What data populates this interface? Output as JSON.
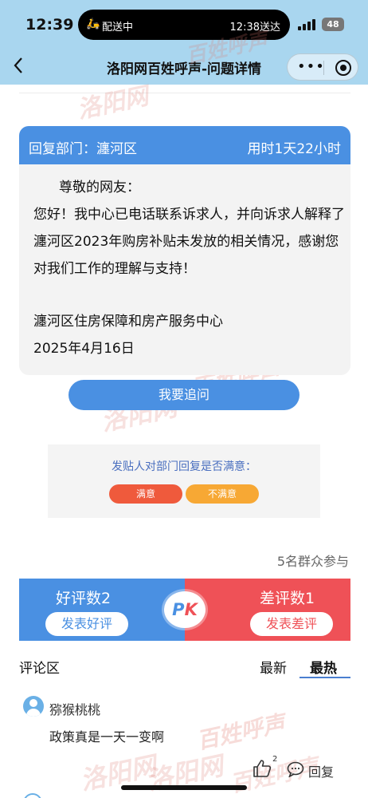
{
  "status_bar": {
    "time": "12:39",
    "island_left": "配送中",
    "island_right": "12:38送达",
    "battery": "48"
  },
  "nav": {
    "title": "洛阳网百姓呼声-问题详情"
  },
  "watermark": {
    "brand": "百姓呼声",
    "site": "洛阳网"
  },
  "reply": {
    "department": "回复部门：瀍河区",
    "elapsed": "用时1天22小时",
    "greeting": "尊敬的网友：",
    "content": "您好！我中心已电话联系诉求人，并向诉求人解释了瀍河区2023年购房补贴未发放的相关情况，感谢您对我们工作的理解与支持！",
    "signature_org": "瀍河区住房保障和房产服务中心",
    "signature_date": "2025年4月16日"
  },
  "follow_up_button": "我要追问",
  "satisfaction": {
    "question": "发贴人对部门回复是否满意：",
    "satisfied": "满意",
    "unsatisfied": "不满意"
  },
  "participants": "5名群众参与",
  "pk": {
    "good_count_label": "好评数2",
    "good_button": "发表好评",
    "badge_p": "P",
    "badge_k": "K",
    "bad_count_label": "差评数1",
    "bad_button": "发表差评"
  },
  "comments": {
    "section_label": "评论区",
    "tab_latest": "最新",
    "tab_hot": "最热",
    "items": [
      {
        "user": "猕猴桃桃",
        "text": "政策真是一天一变啊",
        "likes": "2",
        "reply_label": "回复"
      }
    ]
  },
  "colors": {
    "header_bg": "#a9d6ef",
    "primary_blue": "#4a90e2",
    "pk_red": "#ef5157",
    "satisfied_red": "#ef5a3c",
    "unsatisfied_orange": "#f7a834"
  }
}
